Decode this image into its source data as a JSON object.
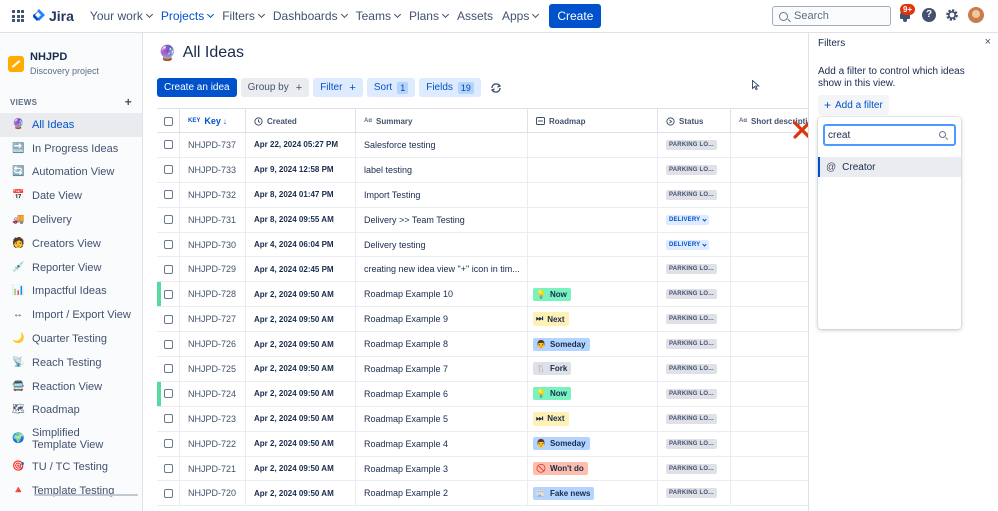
{
  "nav": {
    "logo": "Jira",
    "items": [
      {
        "label": "Your work",
        "active": false
      },
      {
        "label": "Projects",
        "active": true
      },
      {
        "label": "Filters",
        "active": false
      },
      {
        "label": "Dashboards",
        "active": false
      },
      {
        "label": "Teams",
        "active": false
      },
      {
        "label": "Plans",
        "active": false
      },
      {
        "label": "Assets",
        "active": false
      },
      {
        "label": "Apps",
        "active": false
      }
    ],
    "create_label": "Create",
    "search_placeholder": "Search",
    "notification_badge": "9+",
    "help_glyph": "?"
  },
  "sidebar": {
    "project_name": "NHJPD",
    "project_type": "Discovery project",
    "views_header": "VIEWS",
    "views_add": "+",
    "views": [
      {
        "label": "All Ideas",
        "icon": "🔮",
        "selected": true
      },
      {
        "label": "In Progress Ideas",
        "icon": "🔜",
        "selected": false
      },
      {
        "label": "Automation View",
        "icon": "🔄",
        "selected": false
      },
      {
        "label": "Date View",
        "icon": "📅",
        "selected": false
      },
      {
        "label": "Delivery",
        "icon": "🚚",
        "selected": false
      },
      {
        "label": "Creators View",
        "icon": "🧑",
        "selected": false
      },
      {
        "label": "Reporter View",
        "icon": "💉",
        "selected": false
      },
      {
        "label": "Impactful Ideas",
        "icon": "📊",
        "selected": false
      },
      {
        "label": "Import / Export View",
        "icon": "↔",
        "selected": false
      },
      {
        "label": "Quarter Testing",
        "icon": "🌙",
        "selected": false
      },
      {
        "label": "Reach Testing",
        "icon": "📡",
        "selected": false
      },
      {
        "label": "Reaction View",
        "icon": "🚍",
        "selected": false
      },
      {
        "label": "Roadmap",
        "icon": "🗺",
        "selected": false
      },
      {
        "label": "Simplified Template View",
        "icon": "🌍",
        "selected": false,
        "two_line": true
      },
      {
        "label": "TU / TC Testing",
        "icon": "🎯",
        "selected": false
      },
      {
        "label": "Template Testing",
        "icon": "🔺",
        "selected": false
      }
    ]
  },
  "main": {
    "title_emoji": "🔮",
    "title": "All Ideas",
    "toolbar": {
      "create_idea": "Create an idea",
      "group_by": "Group by",
      "filter": "Filter",
      "sort": "Sort",
      "sort_count": "1",
      "fields": "Fields",
      "fields_count": "19",
      "plus": "+"
    }
  },
  "table": {
    "headers": {
      "key_icon": "KEY",
      "key": "Key",
      "created": "Created",
      "summary_icon": "Aα",
      "summary": "Summary",
      "roadmap": "Roadmap",
      "status": "Status",
      "short_icon": "Aα",
      "short": "Short descriptio"
    },
    "rows": [
      {
        "key": "NHJPD-737",
        "created": "Apr 22, 2024 05:27 PM",
        "summary": "Salesforce testing",
        "roadmap": "",
        "roadmap_icon": "",
        "roadmap_color": "",
        "status": "PARKING LO...",
        "status_type": "parking",
        "marked": false
      },
      {
        "key": "NHJPD-733",
        "created": "Apr 9, 2024 12:58 PM",
        "summary": "label testing",
        "roadmap": "",
        "roadmap_icon": "",
        "roadmap_color": "",
        "status": "PARKING LO...",
        "status_type": "parking",
        "marked": false
      },
      {
        "key": "NHJPD-732",
        "created": "Apr 8, 2024 01:47 PM",
        "summary": "Import Testing",
        "roadmap": "",
        "roadmap_icon": "",
        "roadmap_color": "",
        "status": "PARKING LO...",
        "status_type": "parking",
        "marked": false
      },
      {
        "key": "NHJPD-731",
        "created": "Apr 8, 2024 09:55 AM",
        "summary": "Delivery >> Team Testing",
        "roadmap": "",
        "roadmap_icon": "",
        "roadmap_color": "",
        "status": "DELIVERY",
        "status_type": "delivery",
        "marked": false
      },
      {
        "key": "NHJPD-730",
        "created": "Apr 4, 2024 06:04 PM",
        "summary": "Delivery testing",
        "roadmap": "",
        "roadmap_icon": "",
        "roadmap_color": "",
        "status": "DELIVERY",
        "status_type": "delivery",
        "marked": false
      },
      {
        "key": "NHJPD-729",
        "created": "Apr 4, 2024 02:45 PM",
        "summary": "creating new idea view \"+\" icon in tim...",
        "roadmap": "",
        "roadmap_icon": "",
        "roadmap_color": "",
        "status": "PARKING LO...",
        "status_type": "parking",
        "marked": false
      },
      {
        "key": "NHJPD-728",
        "created": "Apr 2, 2024 09:50 AM",
        "summary": "Roadmap Example 10",
        "roadmap": "Now",
        "roadmap_icon": "💡",
        "roadmap_color": "#79f2c0",
        "status": "PARKING LO...",
        "status_type": "parking",
        "marked": true
      },
      {
        "key": "NHJPD-727",
        "created": "Apr 2, 2024 09:50 AM",
        "summary": "Roadmap Example 9",
        "roadmap": "Next",
        "roadmap_icon": "⏭",
        "roadmap_color": "#fff0b3",
        "status": "PARKING LO...",
        "status_type": "parking",
        "marked": false
      },
      {
        "key": "NHJPD-726",
        "created": "Apr 2, 2024 09:50 AM",
        "summary": "Roadmap Example 8",
        "roadmap": "Someday",
        "roadmap_icon": "👨",
        "roadmap_color": "#b3d4ff",
        "status": "PARKING LO...",
        "status_type": "parking",
        "marked": false
      },
      {
        "key": "NHJPD-725",
        "created": "Apr 2, 2024 09:50 AM",
        "summary": "Roadmap Example 7",
        "roadmap": "Fork",
        "roadmap_icon": "🍴",
        "roadmap_color": "#dfe1e6",
        "status": "PARKING LO...",
        "status_type": "parking",
        "marked": false
      },
      {
        "key": "NHJPD-724",
        "created": "Apr 2, 2024 09:50 AM",
        "summary": "Roadmap Example 6",
        "roadmap": "Now",
        "roadmap_icon": "💡",
        "roadmap_color": "#79f2c0",
        "status": "PARKING LO...",
        "status_type": "parking",
        "marked": true
      },
      {
        "key": "NHJPD-723",
        "created": "Apr 2, 2024 09:50 AM",
        "summary": "Roadmap Example 5",
        "roadmap": "Next",
        "roadmap_icon": "⏭",
        "roadmap_color": "#fff0b3",
        "status": "PARKING LO...",
        "status_type": "parking",
        "marked": false
      },
      {
        "key": "NHJPD-722",
        "created": "Apr 2, 2024 09:50 AM",
        "summary": "Roadmap Example 4",
        "roadmap": "Someday",
        "roadmap_icon": "👨",
        "roadmap_color": "#b3d4ff",
        "status": "PARKING LO...",
        "status_type": "parking",
        "marked": false
      },
      {
        "key": "NHJPD-721",
        "created": "Apr 2, 2024 09:50 AM",
        "summary": "Roadmap Example 3",
        "roadmap": "Won't do",
        "roadmap_icon": "🚫",
        "roadmap_color": "#ffbdad",
        "status": "PARKING LO...",
        "status_type": "parking",
        "marked": false
      },
      {
        "key": "NHJPD-720",
        "created": "Apr 2, 2024 09:50 AM",
        "summary": "Roadmap Example 2",
        "roadmap": "Fake news",
        "roadmap_icon": "📰",
        "roadmap_color": "#b3d4ff",
        "status": "PARKING LO...",
        "status_type": "parking",
        "marked": false
      }
    ]
  },
  "filters": {
    "title": "Filters",
    "close": "×",
    "description": "Add a filter to control which ideas show in this view.",
    "add_filter": "Add a filter",
    "plus": "+",
    "search_value": "creat",
    "option_icon": "@",
    "option": "Creator"
  },
  "colors": {
    "brand": "#0052cc",
    "sidebar_bg": "#fafbfc",
    "marked_row": "#57d9a3",
    "annotation_red": "#de350b"
  }
}
